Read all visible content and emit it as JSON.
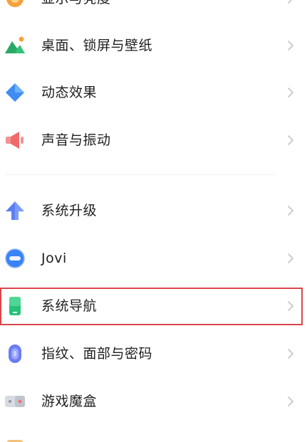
{
  "settings_list": {
    "items": [
      {
        "label": "显示与亮度",
        "icon": "display-brightness-icon",
        "color": "#f6a23a"
      },
      {
        "label": "桌面、锁屏与壁纸",
        "icon": "wallpaper-icon",
        "color": "#35c27a"
      },
      {
        "label": "动态效果",
        "icon": "dynamic-effects-icon",
        "color": "#3f8df4"
      },
      {
        "label": "声音与振动",
        "icon": "sound-vibration-icon",
        "color": "#f06a6a"
      },
      {
        "label": "系统升级",
        "icon": "system-upgrade-icon",
        "color": "#5b7ff2"
      },
      {
        "label": "Jovi",
        "icon": "jovi-icon",
        "color": "#3b82f6"
      },
      {
        "label": "系统导航",
        "icon": "system-navigation-icon",
        "color": "#27c27a"
      },
      {
        "label": "指纹、面部与密码",
        "icon": "fingerprint-face-password-icon",
        "color": "#6b7cf3"
      },
      {
        "label": "游戏魔盒",
        "icon": "game-box-icon",
        "color": "#cfd3da"
      }
    ]
  },
  "highlight": {
    "color": "#d9464a",
    "target": "系统导航"
  }
}
